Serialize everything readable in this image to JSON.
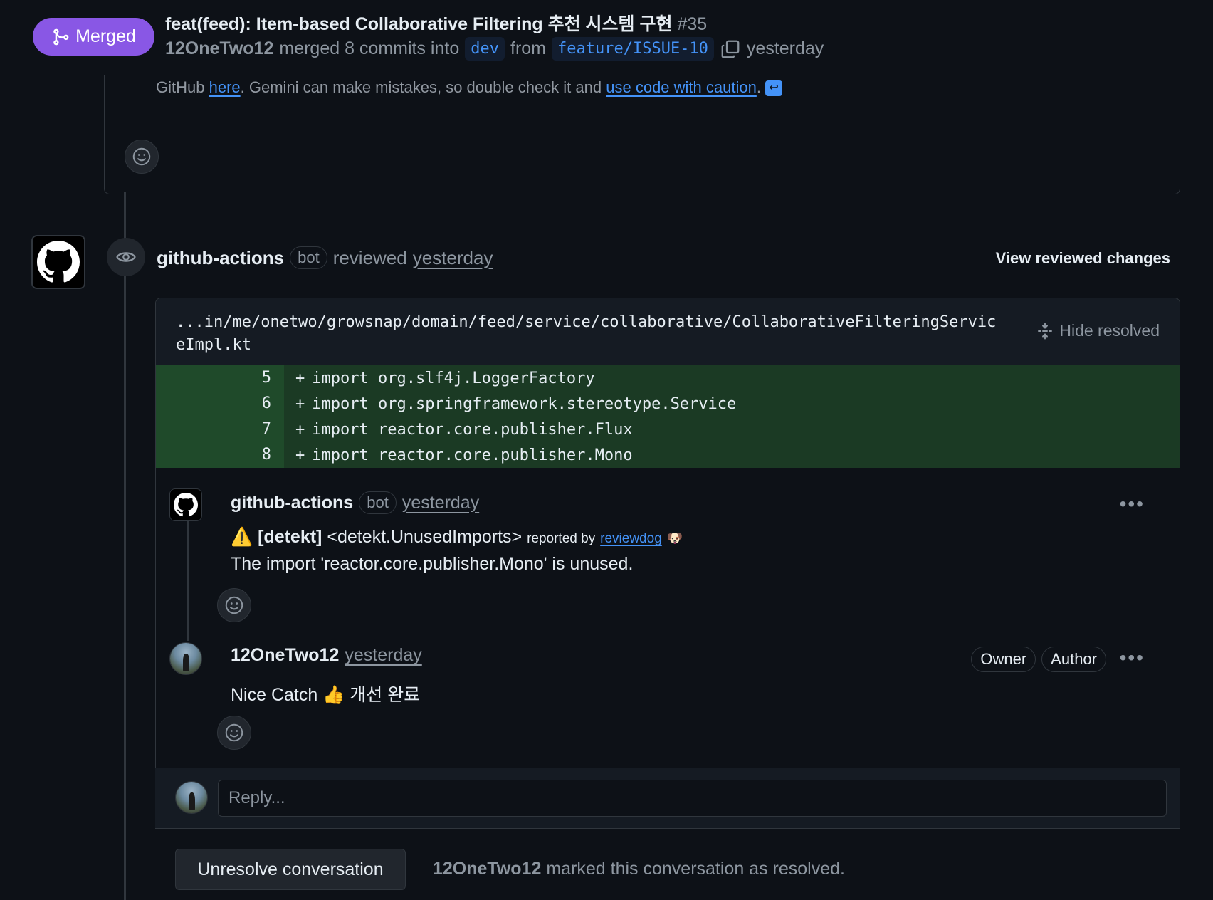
{
  "header": {
    "status": "Merged",
    "title": "feat(feed): Item-based Collaborative Filtering 추천 시스템 구현",
    "number": "#35",
    "author": "12OneTwo12",
    "merged_text": "merged 8 commits into",
    "base_branch": "dev",
    "from_text": "from",
    "head_branch": "feature/ISSUE-10",
    "time": "yesterday"
  },
  "prev_comment": {
    "text_before": "GitHub",
    "link1": "here",
    "text_middle": ". Gemini can make mistakes, so double check it and",
    "link2": "use code with caution",
    "text_end": "."
  },
  "review": {
    "actor": "github-actions",
    "bot_label": "bot",
    "action": "reviewed",
    "time": "yesterday",
    "view_changes": "View reviewed changes"
  },
  "file": {
    "path": "...in/me/onetwo/growsnap/domain/feed/service/collaborative/CollaborativeFilteringServiceImpl.kt",
    "hide_resolved": "Hide resolved"
  },
  "diff_lines": [
    {
      "num": "5",
      "code": "import org.slf4j.LoggerFactory"
    },
    {
      "num": "6",
      "code": "import org.springframework.stereotype.Service"
    },
    {
      "num": "7",
      "code": "import reactor.core.publisher.Flux"
    },
    {
      "num": "8",
      "code": "import reactor.core.publisher.Mono"
    }
  ],
  "comment1": {
    "author": "github-actions",
    "bot_label": "bot",
    "time": "yesterday",
    "warning_icon": "⚠️",
    "tag": "[detekt]",
    "rule": "<detekt.UnusedImports>",
    "reported_by": "reported by",
    "reporter": "reviewdog",
    "reporter_icon": "🐶",
    "message": "The import 'reactor.core.publisher.Mono' is unused.",
    "menu": "•••"
  },
  "comment2": {
    "author": "12OneTwo12",
    "time": "yesterday",
    "owner_label": "Owner",
    "author_label": "Author",
    "body": "Nice Catch 👍 개선 완료",
    "menu": "•••"
  },
  "reply": {
    "placeholder": "Reply..."
  },
  "resolution": {
    "button": "Unresolve conversation",
    "user": "12OneTwo12",
    "text": "marked this conversation as resolved."
  },
  "colors": {
    "merged": "#8957e5",
    "link": "#4493f8",
    "diff_add_bg": "#1b3a24",
    "bg": "#0d1117"
  }
}
